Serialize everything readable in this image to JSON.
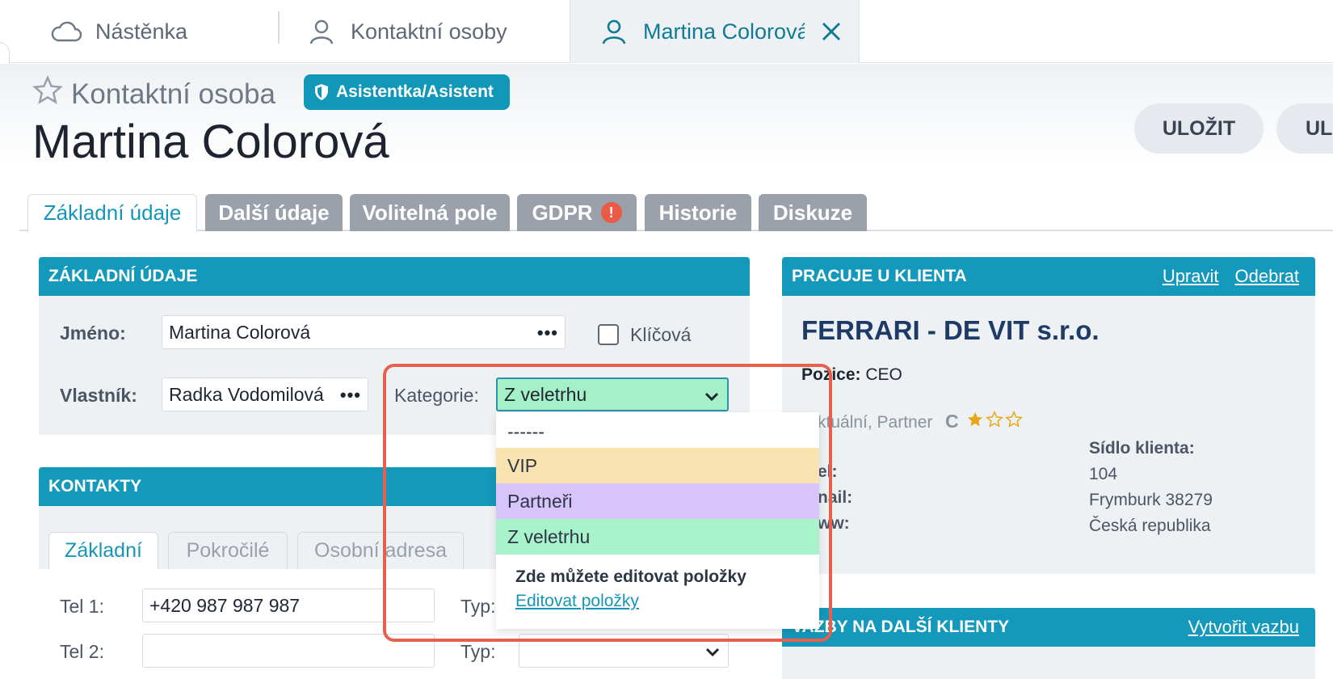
{
  "top_tabs": [
    {
      "label": "Nástěnka",
      "icon": "cloud-icon"
    },
    {
      "label": "Kontaktní osoby",
      "icon": "user-icon"
    },
    {
      "label": "Martina Colorová",
      "icon": "user-icon"
    }
  ],
  "header": {
    "subtitle": "Kontaktní osoba",
    "role_badge": "Asistentka/Asistent",
    "title": "Martina Colorová",
    "save_label": "ULOŽIT",
    "save2_label": "UL"
  },
  "main_tabs": [
    "Základní údaje",
    "Další údaje",
    "Volitelná pole",
    "GDPR",
    "Historie",
    "Diskuze"
  ],
  "gdpr_badge": "!",
  "basic": {
    "heading": "ZÁKLADNÍ ÚDAJE",
    "name_label": "Jméno:",
    "name_value": "Martina Colorová",
    "key_label": "Klíčová",
    "owner_label": "Vlastník:",
    "owner_value": "Radka Vodomilová",
    "category_label": "Kategorie:",
    "category_value": "Z veletrhu"
  },
  "dropdown": {
    "options": [
      "------",
      "VIP",
      "Partneři",
      "Z veletrhu"
    ],
    "option_colors": [
      "#ffffff",
      "#f8e2b0",
      "#d7c4fb",
      "#a9f3cc"
    ],
    "hint": "Zde můžete editovat položky",
    "link": "Editovat položky"
  },
  "contacts": {
    "heading": "KONTAKTY",
    "tabs": [
      "Základní",
      "Pokročilé",
      "Osobní adresa"
    ],
    "tel1_label": "Tel 1:",
    "tel1_value": "+420 987 987 987",
    "tel2_label": "Tel 2:",
    "tel2_value": "",
    "type_label": "Typ:"
  },
  "client": {
    "heading": "PRACUJE U KLIENTA",
    "edit_link": "Upravit",
    "remove_link": "Odebrat",
    "name": "FERRARI - DE VIT s.r.o.",
    "position_label": "Pozice:",
    "position_value": "CEO",
    "tags": "ktuální, Partner",
    "grade": "C",
    "rating": 1,
    "rating_max": 3,
    "tel_label": "el:",
    "email_label": "nail:",
    "www_label": "ww:",
    "seat_label": "Sídlo klienta:",
    "seat_line1": "104",
    "seat_line2": "Frymburk 38279",
    "seat_line3": "Česká republika"
  },
  "relations": {
    "heading": "VAZBY NA DALŠÍ KLIENTY",
    "create_link": "Vytvořit vazbu"
  }
}
